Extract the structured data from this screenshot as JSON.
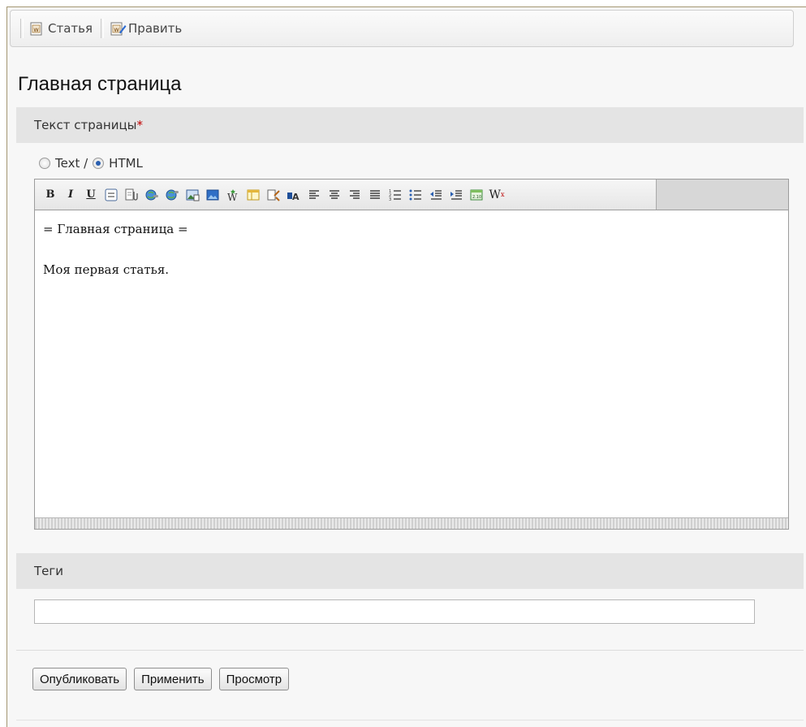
{
  "tabs": [
    {
      "label": "Статья",
      "icon": "document-w-icon"
    },
    {
      "label": "Править",
      "icon": "edit-document-icon"
    }
  ],
  "page_title": "Главная страница",
  "text_section": {
    "label": "Текст страницы",
    "required_mark": "*",
    "format_text_label": "Text /",
    "format_html_label": "HTML",
    "selected_format": "HTML"
  },
  "editor": {
    "toolbar": {
      "bold": "B",
      "italic": "I",
      "underline": "U",
      "wiki": "W",
      "icons": [
        "bold-icon",
        "italic-icon",
        "underline-icon",
        "list-box-icon",
        "attach-icon",
        "link-icon",
        "unlink-icon",
        "media-icon",
        "image-icon",
        "wiki-magic-icon",
        "table-icon",
        "cleanup-icon",
        "font-color-icon",
        "align-left-icon",
        "align-center-icon",
        "align-right-icon",
        "align-justify-icon",
        "ordered-list-icon",
        "unordered-list-icon",
        "outdent-icon",
        "indent-icon",
        "template-icon",
        "remove-format-icon"
      ]
    },
    "content_lines": [
      "= Главная страница =",
      "Моя первая статья."
    ]
  },
  "tags_section": {
    "label": "Теги",
    "value": ""
  },
  "actions": {
    "publish": "Опубликовать",
    "apply": "Применить",
    "preview": "Просмотр"
  },
  "colors": {
    "required": "#c00000",
    "section_bg": "#e4e4e4",
    "radio_dot": "#2a5fb0"
  }
}
